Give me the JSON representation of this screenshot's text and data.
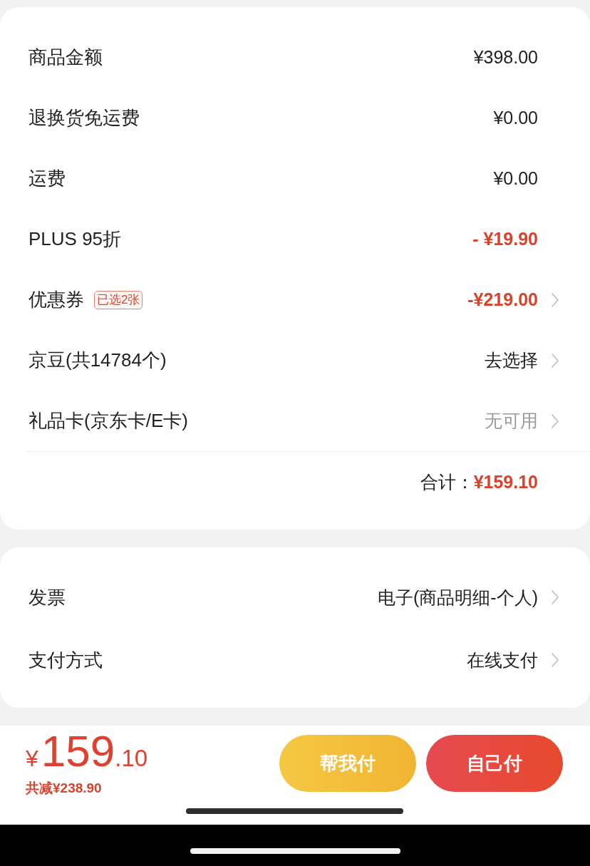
{
  "charges": {
    "rows": [
      {
        "kind": "amount",
        "label": "商品金额",
        "value": "¥398.00",
        "highlighted": false,
        "disabled": false
      },
      {
        "kind": "amount",
        "label": "退换货免运费",
        "value": "¥0.00",
        "highlighted": false,
        "disabled": false
      },
      {
        "kind": "amount",
        "label": "运费",
        "value": "¥0.00",
        "highlighted": false,
        "disabled": false
      },
      {
        "kind": "amount",
        "label": "PLUS 95折",
        "value": "- ¥19.90",
        "highlighted": true,
        "disabled": false
      },
      {
        "kind": "link",
        "label": "优惠券",
        "badge": "已选2张",
        "value": "-¥219.00",
        "highlighted": true,
        "disabled": false
      },
      {
        "kind": "link",
        "label": "京豆(共14784个)",
        "value": "去选择",
        "highlighted": false,
        "disabled": false
      },
      {
        "kind": "link",
        "label": "礼品卡(京东卡/E卡)",
        "value": "无可用",
        "highlighted": false,
        "disabled": true
      }
    ],
    "total": {
      "label": "合计：",
      "value": "¥159.10"
    }
  },
  "options": {
    "rows": [
      {
        "kind": "link",
        "label": "发票",
        "value": "电子(商品明细-个人)",
        "highlighted": false,
        "disabled": false
      },
      {
        "kind": "link",
        "label": "支付方式",
        "value": "在线支付",
        "highlighted": false,
        "disabled": false
      }
    ]
  },
  "checkout_bar": {
    "price": {
      "currency": "¥",
      "integer": "159",
      "decimal": ".10"
    },
    "savings": "共减¥238.90",
    "buttons": [
      {
        "label": "帮我付",
        "kind": "secondary"
      },
      {
        "label": "自己付",
        "kind": "primary"
      }
    ]
  }
}
